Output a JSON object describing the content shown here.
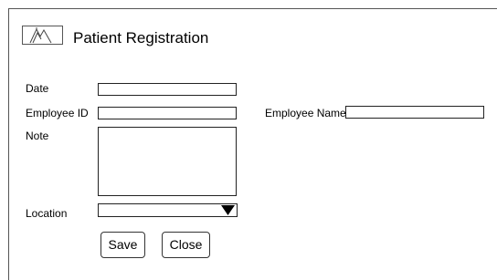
{
  "header": {
    "title": "Patient Registration",
    "logo_icon": "mountain-image-icon"
  },
  "form": {
    "date_label": "Date",
    "date_value": "",
    "employee_id_label": "Employee ID",
    "employee_id_value": "",
    "employee_name_label": "Employee Name",
    "employee_name_value": "",
    "note_label": "Note",
    "note_value": "",
    "location_label": "Location",
    "location_value": "",
    "location_arrow_icon": "triangle-down-icon"
  },
  "buttons": {
    "save_label": "Save",
    "close_label": "Close"
  }
}
